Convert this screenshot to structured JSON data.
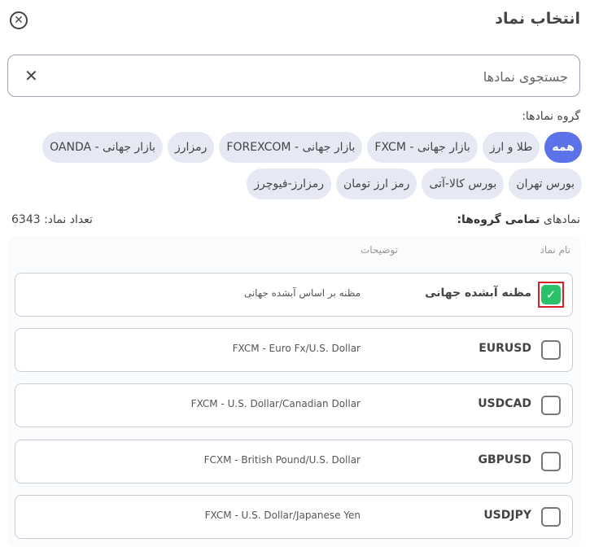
{
  "header": {
    "title": "انتخاب نماد",
    "close_icon": "close-circle-icon"
  },
  "search": {
    "placeholder": "جستجوی نمادها",
    "value": "",
    "clear_icon": "close-icon"
  },
  "groups": {
    "label": "گروه نمادها:",
    "row1": [
      "همه",
      "طلا و ارز",
      "بازار جهانی - FXCM",
      "بازار جهانی - FOREXCOM",
      "رمزارز",
      "بازار جهانی - OANDA"
    ],
    "row2": [
      "بورس تهران",
      "بورس کالا-آتی",
      "رمز ارز تومان",
      "رمزارز-فیوچرز"
    ],
    "active": "همه",
    "accent_color": "#5b72e8"
  },
  "summary": {
    "prefix": "نمادهای",
    "group_name": "تمامی گروه‌ها:",
    "count_label": "تعداد نماد: 6343"
  },
  "table": {
    "col_name": "نام نماد",
    "col_desc": "توضیحات",
    "rows": [
      {
        "symbol": "مظنه آبشده جهانی",
        "description": "مظنه بر اساس آبشده جهانی",
        "checked": true
      },
      {
        "symbol": "EURUSD",
        "description": "FXCM - Euro Fx/U.S. Dollar",
        "checked": false
      },
      {
        "symbol": "USDCAD",
        "description": "FXCM - U.S. Dollar/Canadian Dollar",
        "checked": false
      },
      {
        "symbol": "GBPUSD",
        "description": "FCXM - British Pound/U.S. Dollar",
        "checked": false
      },
      {
        "symbol": "USDJPY",
        "description": "FXCM - U.S. Dollar/Japanese Yen",
        "checked": false
      }
    ],
    "check_color": "#29c26a"
  }
}
